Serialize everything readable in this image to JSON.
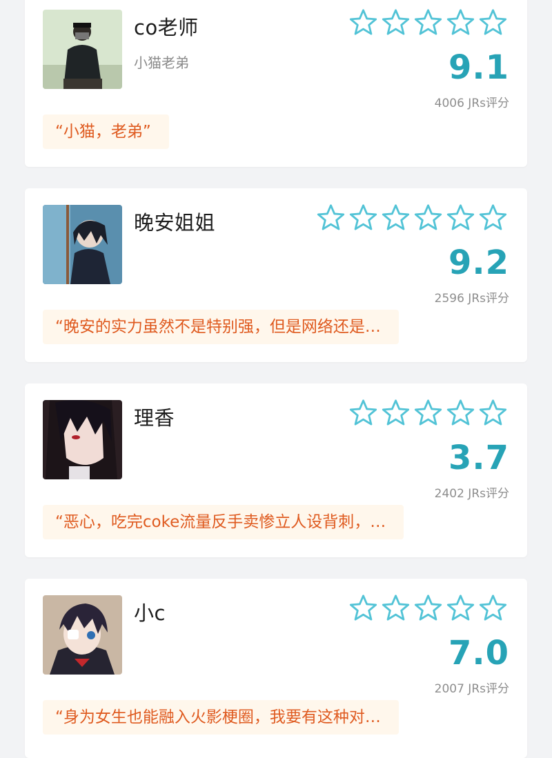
{
  "reviews": [
    {
      "name": "co老师",
      "alias": "小猫老弟",
      "score": "9.1",
      "count": "4006 JRs评分",
      "quote": "“小猫，老弟”"
    },
    {
      "name": "晚安姐姐",
      "alias": "",
      "score": "9.2",
      "count": "2596 JRs评分",
      "quote": "“晚安的实力虽然不是特别强，但是网络还是…"
    },
    {
      "name": "理香",
      "alias": "",
      "score": "3.7",
      "count": "2402 JRs评分",
      "quote": "“恶心，吃完coke流量反手卖惨立人设背刺，…"
    },
    {
      "name": "小c",
      "alias": "",
      "score": "7.0",
      "count": "2007 JRs评分",
      "quote": "“身为女生也能融入火影梗圈，我要有这种对…"
    }
  ],
  "colors": {
    "accent": "#27a3b6",
    "star_outline": "#52c3d6",
    "quote_text": "#df5a1f",
    "quote_bg": "#fff7ec"
  },
  "icons": {
    "star": "star-outline-icon"
  }
}
